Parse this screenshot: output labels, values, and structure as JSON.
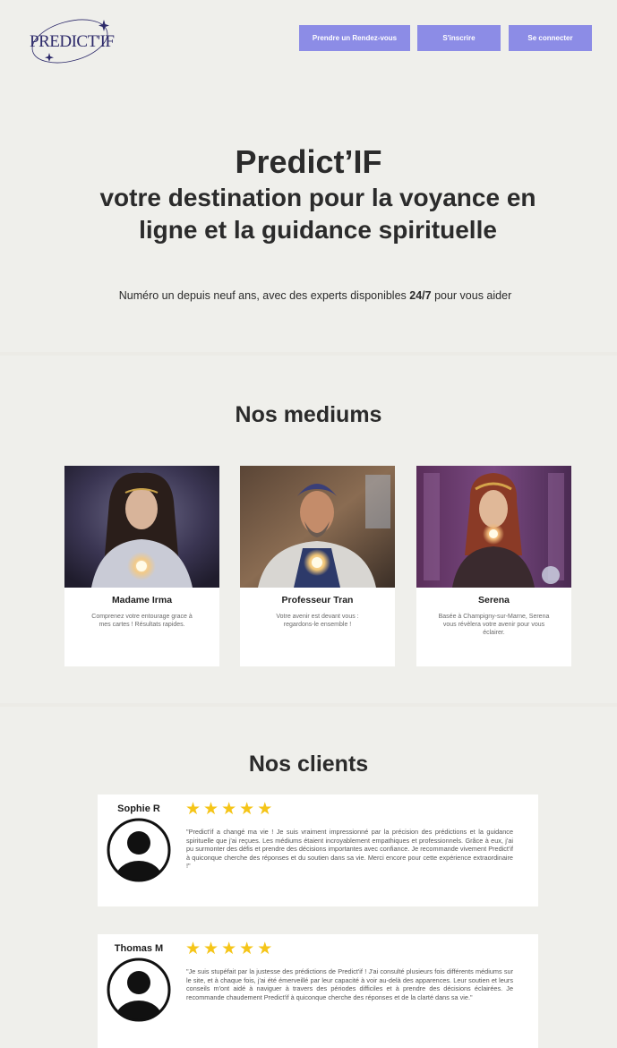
{
  "header": {
    "logo_text": "PREDICT'IF",
    "nav": {
      "rdv_label": "Prendre un Rendez-vous",
      "inscrire_label": "S'inscrire",
      "connecter_label": "Se connecter"
    }
  },
  "hero": {
    "title": "Predict’IF",
    "subtitle": "votre destination pour la voyance en ligne et la guidance spirituelle",
    "tagline_before": "Numéro un depuis neuf ans, avec des experts disponibles ",
    "tagline_bold": "24/7",
    "tagline_after": " pour vous aider"
  },
  "mediums": {
    "title": "Nos mediums",
    "items": [
      {
        "name": "Madame Irma",
        "description": "Comprenez votre entourage grace à mes cartes ! Résultats rapides."
      },
      {
        "name": "Professeur Tran",
        "description": "Votre avenir est devant vous : regardons-le ensemble !"
      },
      {
        "name": "Serena",
        "description": "Basée à Champigny-sur-Marne, Serena vous révèlera votre avenir pour vous éclairer."
      }
    ]
  },
  "clients": {
    "title": "Nos clients",
    "items": [
      {
        "name": "Sophie R",
        "rating": 5,
        "text": "\"Predict'if a changé ma vie ! Je suis vraiment impressionné par la précision des prédictions et la guidance spirituelle que j'ai reçues. Les médiums étaient incroyablement empathiques et professionnels. Grâce à eux, j'ai pu surmonter des défis et prendre des décisions importantes avec confiance. Je recommande vivement Predict'if à quiconque cherche des réponses et du soutien dans sa vie. Merci encore pour cette expérience extraordinaire !\""
      },
      {
        "name": "Thomas M",
        "rating": 5,
        "text": "\"Je suis stupéfait par la justesse des prédictions de Predict'if ! J'ai consulté plusieurs fois différents médiums sur le site, et à chaque fois, j'ai été émerveillé par leur capacité à voir au-delà des apparences. Leur soutien et leurs conseils m'ont aidé à naviguer à travers des périodes difficiles et à prendre des décisions éclairées. Je recommande chaudement Predict'if à quiconque cherche des réponses et de la clarté dans sa vie.\""
      }
    ]
  },
  "colors": {
    "accent": "#8c8ce6",
    "background": "#efefeb",
    "star": "#f5c518",
    "logo": "#2d2a6a"
  }
}
